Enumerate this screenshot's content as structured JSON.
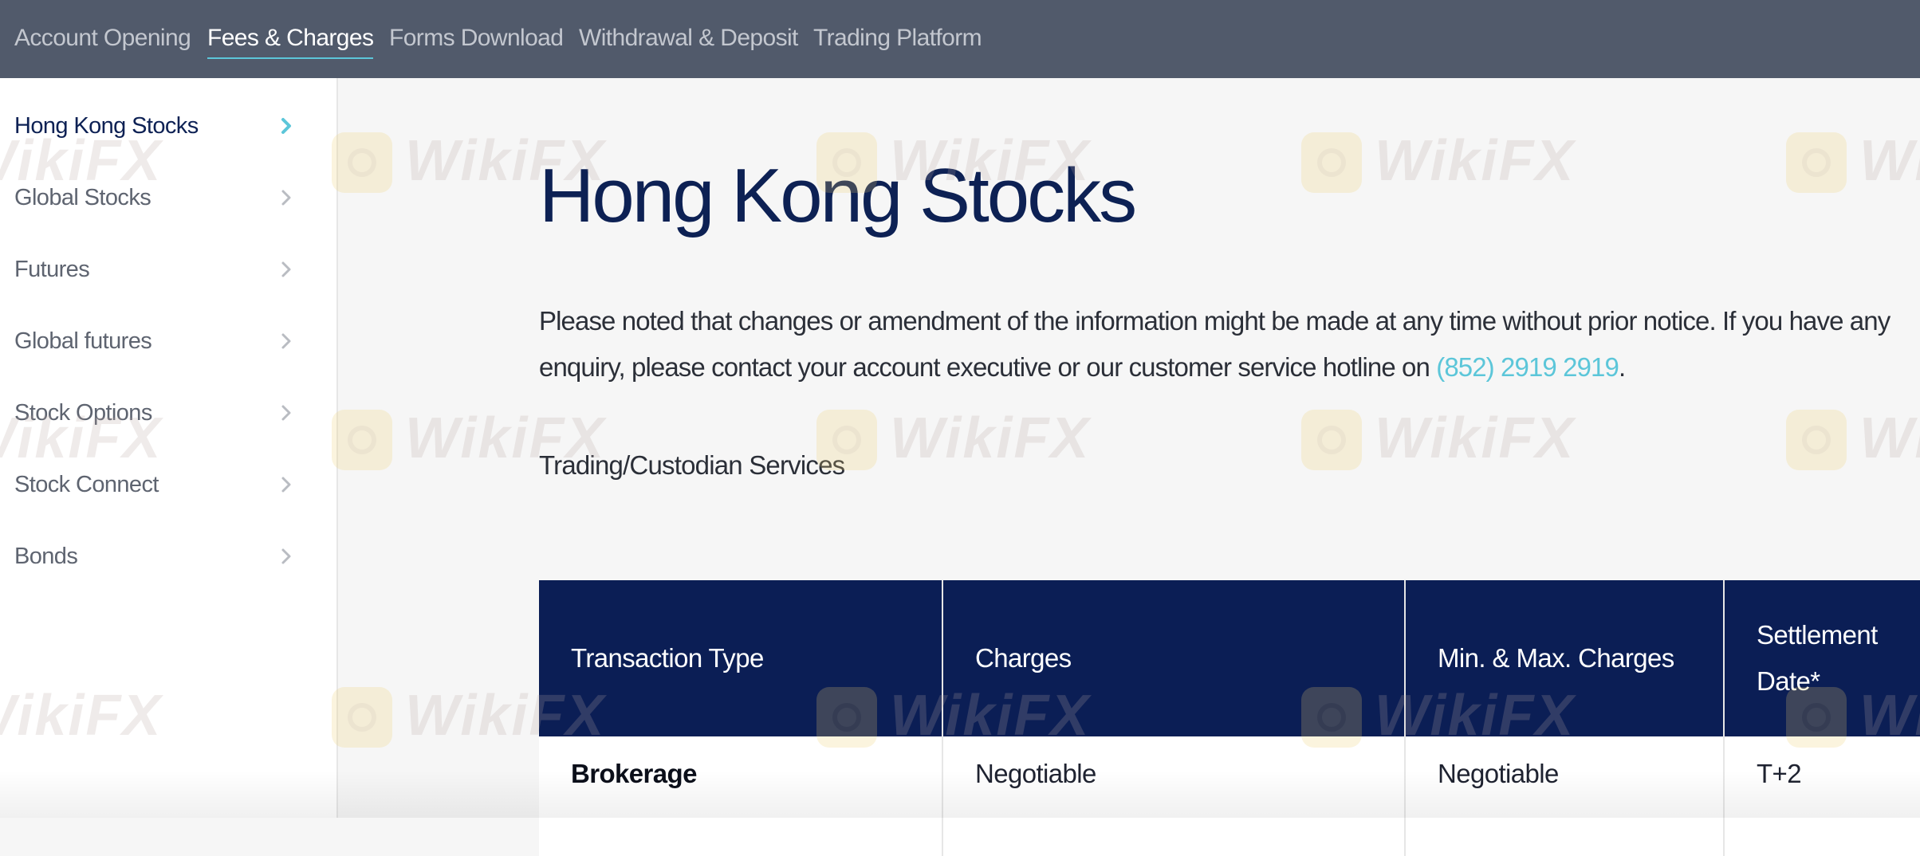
{
  "topnav": {
    "tabs": [
      {
        "label": "Account Opening",
        "active": false
      },
      {
        "label": "Fees & Charges",
        "active": true
      },
      {
        "label": "Forms Download",
        "active": false
      },
      {
        "label": "Withdrawal & Deposit",
        "active": false
      },
      {
        "label": "Trading Platform",
        "active": false
      }
    ]
  },
  "sidebar": {
    "items": [
      {
        "label": "Hong Kong Stocks",
        "active": true
      },
      {
        "label": "Global Stocks",
        "active": false
      },
      {
        "label": "Futures",
        "active": false
      },
      {
        "label": "Global futures",
        "active": false
      },
      {
        "label": "Stock Options",
        "active": false
      },
      {
        "label": "Stock Connect",
        "active": false
      },
      {
        "label": "Bonds",
        "active": false
      }
    ],
    "chevron_icon": "chevron-right-icon"
  },
  "main": {
    "title": "Hong Kong Stocks",
    "intro_text": "Please noted that changes or amendment of the information might be made at any time without prior notice. If you have any enquiry, please contact your account executive or our customer service hotline on ",
    "phone": "(852) 2919 2919",
    "intro_end": ".",
    "section_title": "Trading/Custodian Services"
  },
  "table": {
    "headers": [
      "Transaction Type",
      "Charges",
      "Min. & Max. Charges",
      "Settlement Date*"
    ],
    "rows": [
      [
        "Brokerage",
        "Negotiable",
        "Negotiable",
        "T+2"
      ]
    ]
  },
  "watermark": {
    "text": "WikiFX"
  },
  "colors": {
    "nav_bg": "#515a6b",
    "accent": "#5cc6d9",
    "navy": "#0b1e55",
    "page_bg": "#f6f6f6"
  }
}
